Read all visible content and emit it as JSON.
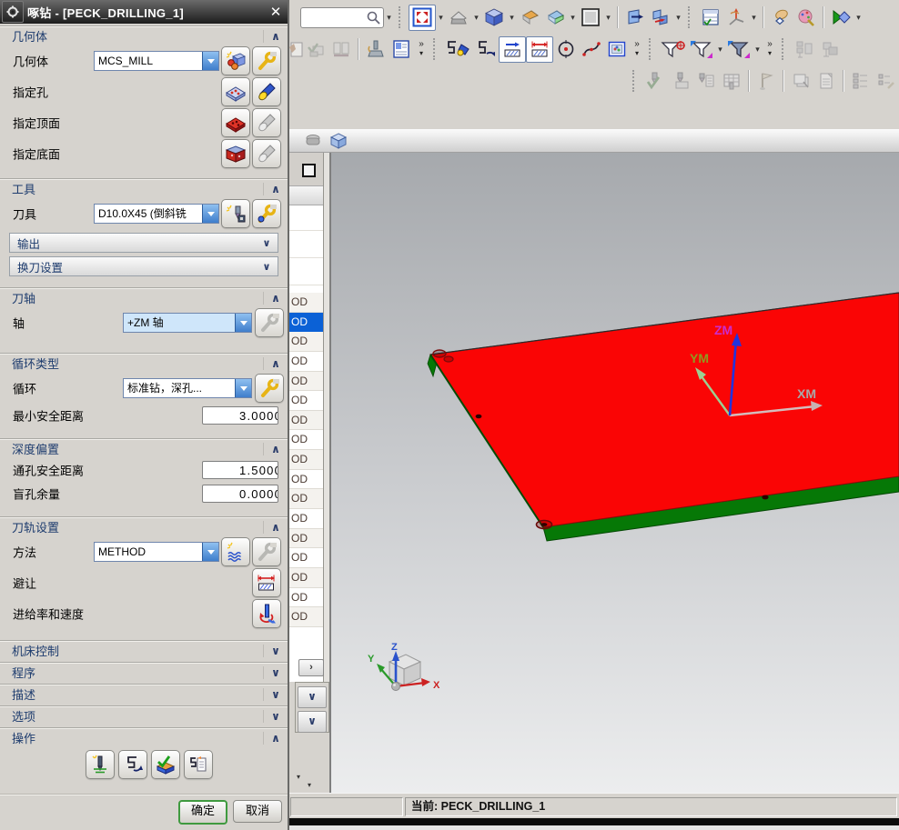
{
  "ui": {
    "caret": "▾",
    "overflow": "»",
    "chevron_up": "∧",
    "chevron_down": "∨",
    "expand_right": "›",
    "close": "✕"
  },
  "colors": {
    "plate_red": "#fa0505",
    "plate_edge_green": "#067806",
    "selection_blue": "#0b61d6",
    "dialog_bg": "#d6d3ce",
    "title_bar_dark": "#1c1c1c",
    "ok_border_green": "#3f9a3f",
    "combo_highlight_blue": "#cfe6fa",
    "axis_zm_arrow": "#2233dd",
    "axis_ym_arrow": "#9ccf92",
    "axis_xm_arrow": "#d4bcbc",
    "label_zm": "#cc2ccc",
    "label_ym": "#8f9a1f",
    "label_xm": "#a8a8a8",
    "wcs_x": "#cc2222",
    "wcs_y": "#2a9a2a",
    "wcs_z": "#2a52cc"
  },
  "dialog": {
    "title": "啄钻 - [PECK_DRILLING_1]",
    "geometry": {
      "header": "几何体",
      "label": "几何体",
      "value": "MCS_MILL",
      "holes_label": "指定孔",
      "top_label": "指定顶面",
      "bottom_label": "指定底面"
    },
    "tool": {
      "header": "工具",
      "label": "刀具",
      "value": "D10.0X45 (倒斜铣",
      "output_label": "输出",
      "change_label": "换刀设置"
    },
    "axis": {
      "header": "刀轴",
      "label": "轴",
      "value": "+ZM 轴"
    },
    "cycle": {
      "header": "循环类型",
      "label": "循环",
      "value": "标准钻，深孔...",
      "min_clearance_label": "最小安全距离",
      "min_clearance_value": "3.0000"
    },
    "depth": {
      "header": "深度偏置",
      "through_label": "通孔安全距离",
      "through_value": "1.5000",
      "blind_label": "盲孔余量",
      "blind_value": "0.0000"
    },
    "path": {
      "header": "刀轨设置",
      "method_label": "方法",
      "method_value": "METHOD",
      "avoid_label": "避让",
      "feeds_label": "进给率和速度"
    },
    "collapsed": {
      "machine_control": "机床控制",
      "program": "程序",
      "description": "描述",
      "options": "选项"
    },
    "actions": {
      "header": "操作",
      "icons": [
        "generate-toolpath",
        "replay-toolpath",
        "verify-toolpath",
        "list-toolpath"
      ]
    },
    "ok": "确定",
    "cancel": "取消"
  },
  "navigator": {
    "rows": [
      "OD",
      "OD",
      "OD",
      "OD",
      "OD",
      "OD",
      "OD",
      "OD",
      "OD",
      "OD",
      "OD",
      "OD",
      "OD",
      "OD",
      "OD",
      "OD",
      "OD"
    ],
    "selected_index": 1
  },
  "statusbar": {
    "text": "当前: PECK_DRILLING_1"
  },
  "viewport": {
    "mcs": {
      "zm": "ZM",
      "ym": "YM",
      "xm": "XM"
    },
    "wcs": {
      "x": "X",
      "y": "Y",
      "z": "Z"
    }
  },
  "search": {
    "value": ""
  },
  "toolbars": {
    "row1": [
      "search-box",
      "fit-view",
      "orient-view",
      "rendering-style",
      "face-analysis-orange",
      "face-analysis-green",
      "background-color",
      "clip-section",
      "clip-section-alt",
      "operation-navigator",
      "csys",
      "snap-hand",
      "role-palette",
      "play-diamond"
    ],
    "row2": [
      "postprocess-partial",
      "verify-disabled",
      "books-disabled",
      "machine-simulation",
      "shop-docs",
      "show-toolpath",
      "replay-toolpath",
      "edit-display-1",
      "edit-display-2",
      "point-circle",
      "spline",
      "image-frame",
      "filter-crosshair",
      "filter-light",
      "filter-dark",
      "machine-disabled-1",
      "machine-disabled-2"
    ],
    "row3": [
      "tool-check",
      "tool-block",
      "tool-list",
      "grid-table",
      "flag",
      "images",
      "document",
      "list-pair",
      "list-wrench"
    ],
    "selection_bar": [
      "snap-object",
      "cube-translucent"
    ]
  }
}
